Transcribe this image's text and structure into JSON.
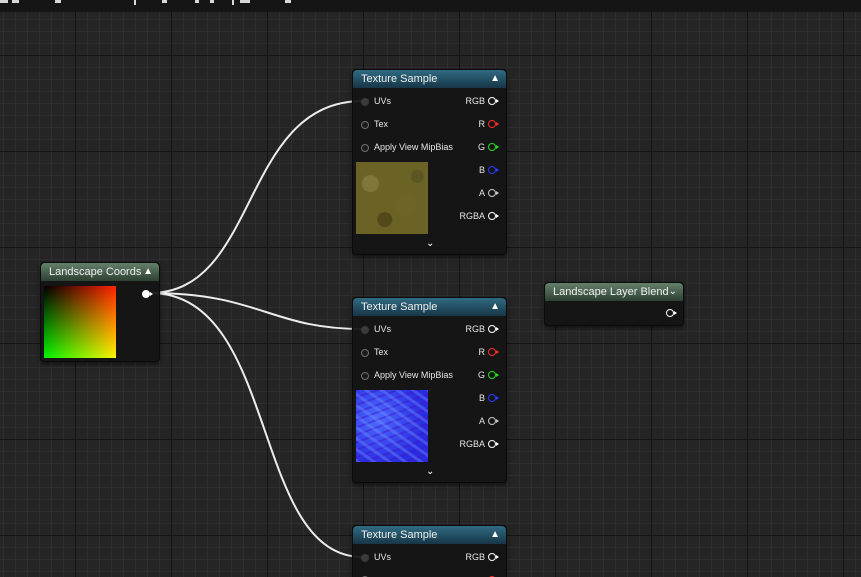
{
  "graph": {
    "nodes": {
      "landscape_coords": {
        "title": "Landscape Coords",
        "collapse_icon": "chevron-up-icon"
      },
      "texture_samples": [
        {
          "title": "Texture Sample",
          "inputs": [
            "UVs",
            "Tex",
            "Apply View MipBias"
          ],
          "outputs": [
            "RGB",
            "R",
            "G",
            "B",
            "A",
            "RGBA"
          ],
          "preview": "dirt-texture",
          "expand_icon": "chevron-down-icon"
        },
        {
          "title": "Texture Sample",
          "inputs": [
            "UVs",
            "Tex",
            "Apply View MipBias"
          ],
          "outputs": [
            "RGB",
            "R",
            "G",
            "B",
            "A",
            "RGBA"
          ],
          "preview": "normal-map-texture",
          "expand_icon": "chevron-down-icon"
        },
        {
          "title": "Texture Sample",
          "inputs": [
            "UVs"
          ],
          "outputs": [
            "RGB"
          ]
        }
      ],
      "landscape_layer_blend": {
        "title": "Landscape Layer Blend",
        "dropdown_icon": "chevron-down-icon"
      }
    },
    "pin_colors": {
      "RGB": "#ffffff",
      "R": "#ff2a2a",
      "G": "#22e022",
      "B": "#2b3bff",
      "A": "#c8c8c8",
      "RGBA": "#ffffff"
    },
    "header_colors": {
      "texture_sample": "#2f6a82",
      "landscape": "#63806a"
    }
  }
}
